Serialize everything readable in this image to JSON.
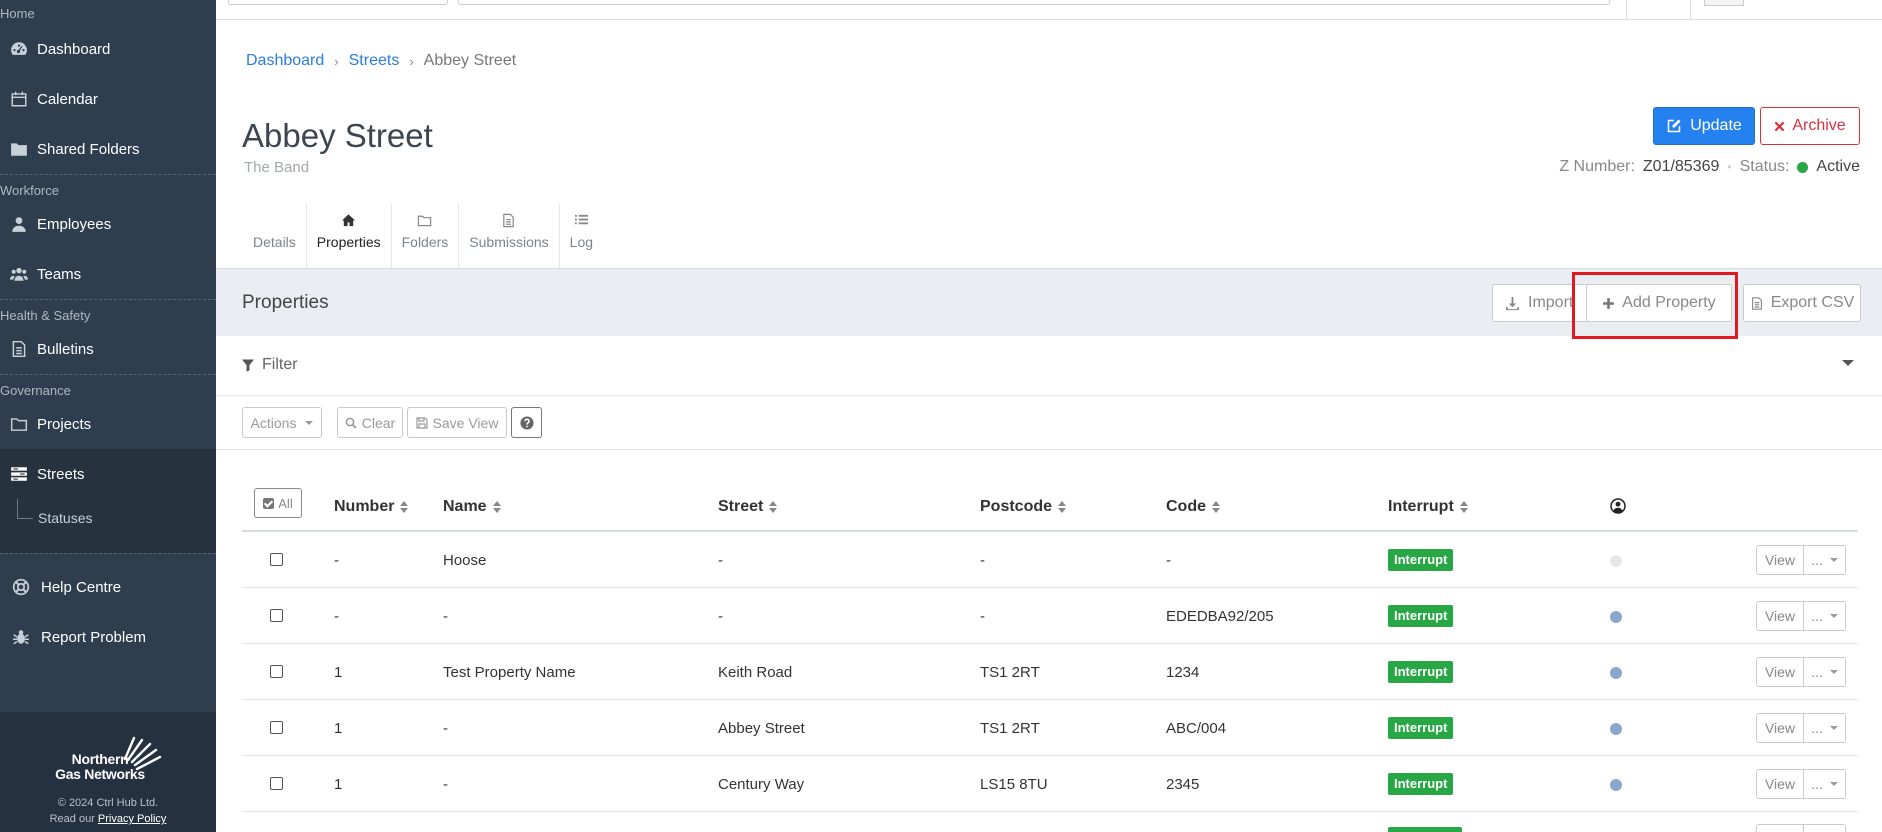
{
  "sidebar": {
    "sections": [
      {
        "label": "Home",
        "items": [
          {
            "label": "Dashboard",
            "icon": "dashboard-icon"
          },
          {
            "label": "Calendar",
            "icon": "calendar-icon"
          },
          {
            "label": "Shared Folders",
            "icon": "folder-icon"
          }
        ]
      },
      {
        "label": "Workforce",
        "items": [
          {
            "label": "Employees",
            "icon": "user-icon"
          },
          {
            "label": "Teams",
            "icon": "users-icon"
          }
        ]
      },
      {
        "label": "Health & Safety",
        "items": [
          {
            "label": "Bulletins",
            "icon": "document-icon"
          }
        ]
      },
      {
        "label": "Governance",
        "items": [
          {
            "label": "Projects",
            "icon": "folder-icon"
          },
          {
            "label": "Streets",
            "icon": "streets-icon"
          }
        ]
      }
    ],
    "sub_item": "Statuses",
    "help": "Help Centre",
    "report": "Report Problem",
    "logo_line1": "Northern",
    "logo_line2": "Gas Networks",
    "copyright": "© 2024 Ctrl Hub Ltd.",
    "privacy_prefix": "Read our",
    "privacy_link": "Privacy Policy"
  },
  "breadcrumb": {
    "dashboard": "Dashboard",
    "streets": "Streets",
    "current": "Abbey Street"
  },
  "header": {
    "title": "Abbey Street",
    "subtitle": "The Band",
    "update_label": "Update",
    "archive_label": "Archive",
    "z_number_label": "Z Number:",
    "z_number": "Z01/85369",
    "status_label": "Status:",
    "status": "Active",
    "status_color": "#28a745"
  },
  "tabs": [
    {
      "label": "Details"
    },
    {
      "label": "Properties"
    },
    {
      "label": "Folders"
    },
    {
      "label": "Submissions"
    },
    {
      "label": "Log"
    }
  ],
  "panel": {
    "title": "Properties",
    "import_label": "Import",
    "add_label": "Add Property",
    "export_label": "Export CSV",
    "filter_label": "Filter",
    "actions_label": "Actions",
    "clear_label": "Clear",
    "save_view_label": "Save View"
  },
  "table": {
    "all_label": "All",
    "columns": {
      "number": "Number",
      "name": "Name",
      "street": "Street",
      "postcode": "Postcode",
      "code": "Code",
      "interrupt": "Interrupt"
    },
    "view_label": "View",
    "more_label": "...",
    "rows": [
      {
        "number": "-",
        "name": "Hoose",
        "street": "-",
        "postcode": "-",
        "code": "-",
        "interrupt": "Interrupt"
      },
      {
        "number": "-",
        "name": "-",
        "street": "-",
        "postcode": "-",
        "code": "EDEDBA92/205",
        "interrupt": "Interrupt"
      },
      {
        "number": "1",
        "name": "Test Property Name",
        "street": "Keith Road",
        "postcode": "TS1 2RT",
        "code": "1234",
        "interrupt": "Interrupt"
      },
      {
        "number": "1",
        "name": "-",
        "street": "Abbey Street",
        "postcode": "TS1 2RT",
        "code": "ABC/004",
        "interrupt": "Interrupt"
      },
      {
        "number": "1",
        "name": "-",
        "street": "Century Way",
        "postcode": "LS15 8TU",
        "code": "2345",
        "interrupt": "Interrupt"
      }
    ]
  },
  "colors": {
    "primary": "#2580f0",
    "danger": "#d9303e",
    "success": "#28a745",
    "sidebar": "#2e3e4f",
    "highlight": "#e11a22"
  }
}
